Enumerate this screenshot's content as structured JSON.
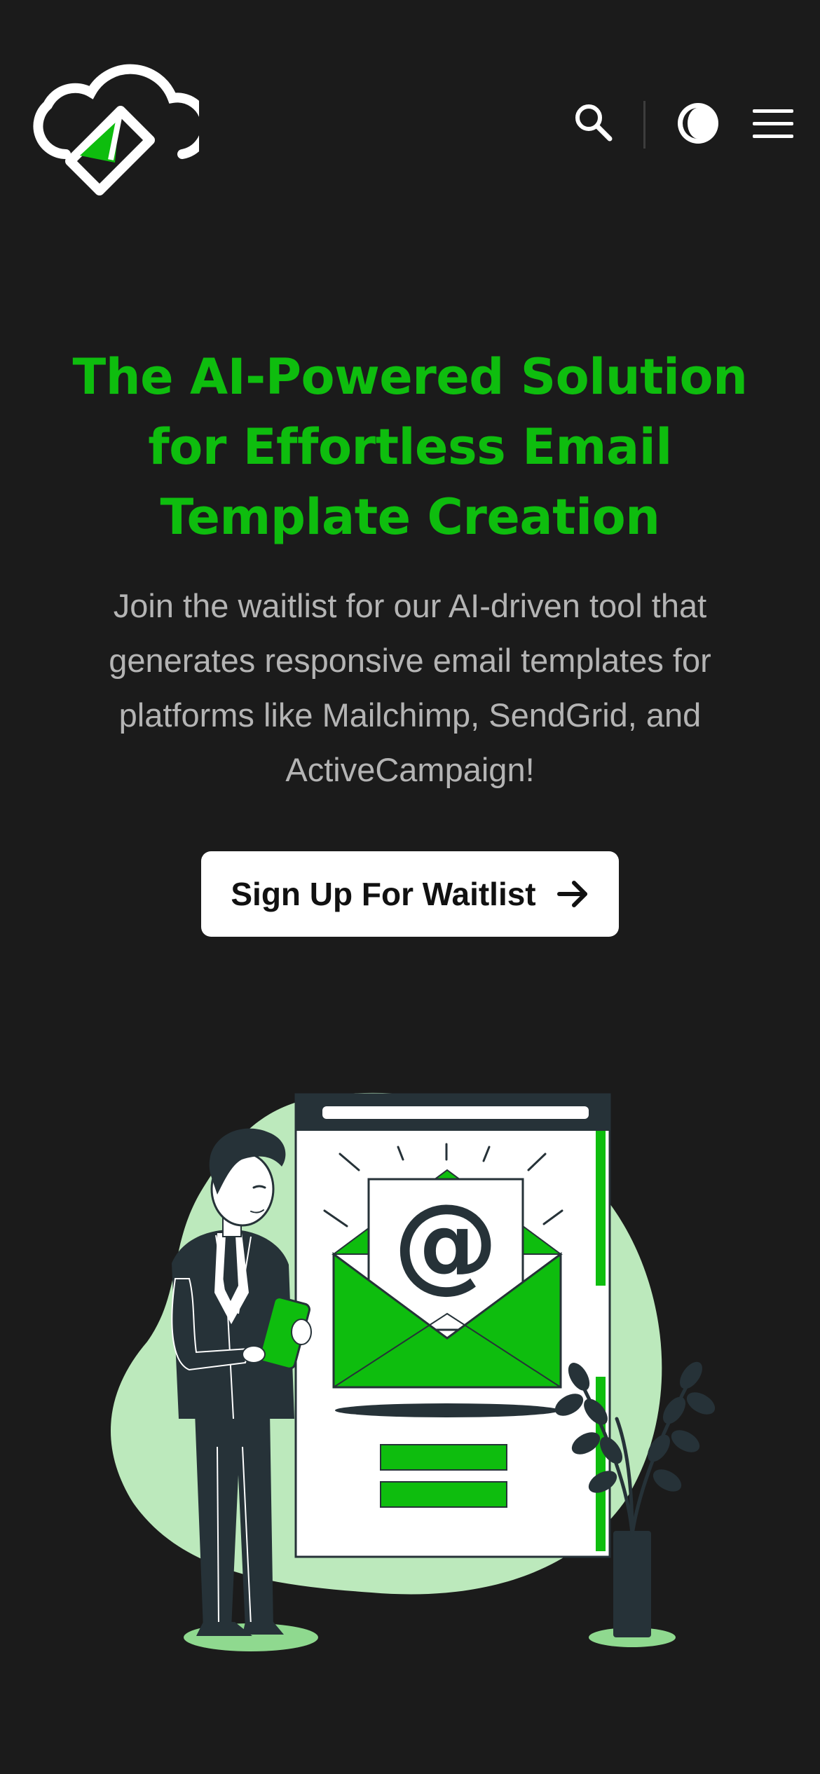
{
  "header": {
    "logo_icon": "cloud-envelope-logo",
    "search_icon": "search-icon",
    "theme_icon": "half-moon-theme-icon",
    "menu_icon": "hamburger-menu-icon"
  },
  "hero": {
    "title": "The AI-Powered Solution for Effortless Email Template Creation",
    "subtitle": "Join the waitlist for our AI-driven tool that generates responsive email templates for platforms like Mailchimp, SendGrid, and ActiveCampaign!",
    "cta_label": "Sign Up For Waitlist",
    "cta_icon": "arrow-right-icon"
  },
  "illustration": {
    "at_symbol": "@",
    "description_icon": "businessman-email-illustration"
  },
  "colors": {
    "background": "#1b1b1b",
    "accent": "#0ebd0e",
    "accent_light": "#bce9bc",
    "text_muted": "#b4b4b4",
    "button_bg": "#ffffff",
    "dark_figure": "#263238"
  }
}
